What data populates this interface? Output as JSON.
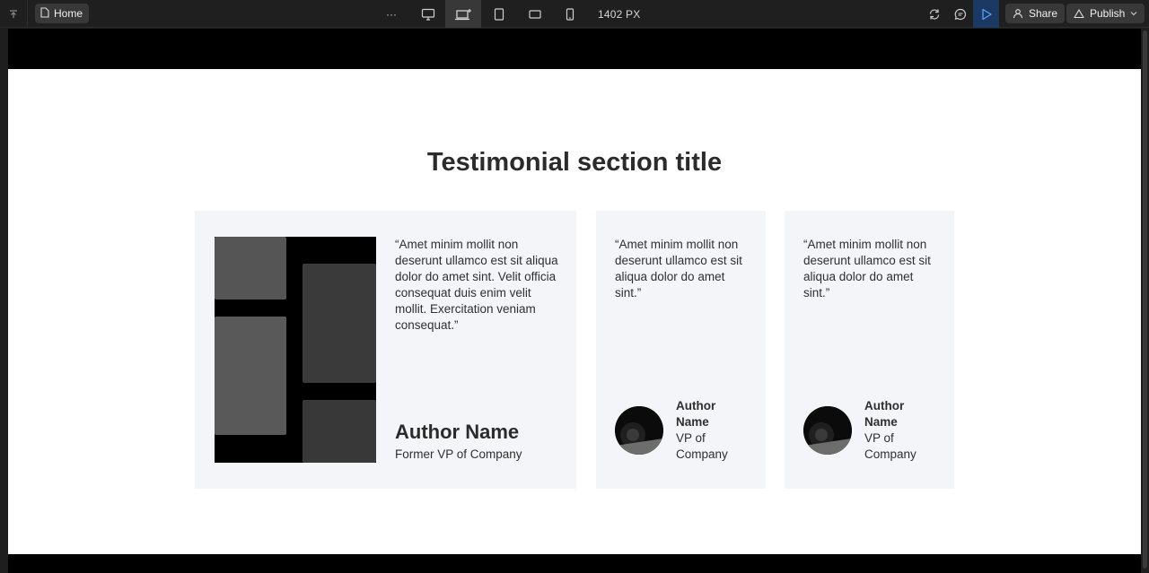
{
  "toolbar": {
    "home_tab_label": "Home",
    "more_label": "···",
    "viewport_width_label": "1402 PX",
    "share_label": "Share",
    "publish_label": "Publish",
    "play_color": "#1b3a63"
  },
  "page": {
    "section_title": "Testimonial section title",
    "featured": {
      "quote": "“Amet minim mollit non deserunt ullamco est sit aliqua dolor do amet sint. Velit officia consequat duis enim velit mollit. Exercitation veniam consequat.”",
      "author_name": "Author Name",
      "author_role": "Former VP of Company"
    },
    "cards": [
      {
        "quote": "“Amet minim mollit non deserunt ullamco est sit aliqua dolor do amet sint.”",
        "author_name": "Author Name",
        "author_role": "VP of Company"
      },
      {
        "quote": "“Amet minim mollit non deserunt ullamco est sit aliqua dolor do amet sint.”",
        "author_name": "Author Name",
        "author_role": "VP of Company"
      }
    ]
  }
}
